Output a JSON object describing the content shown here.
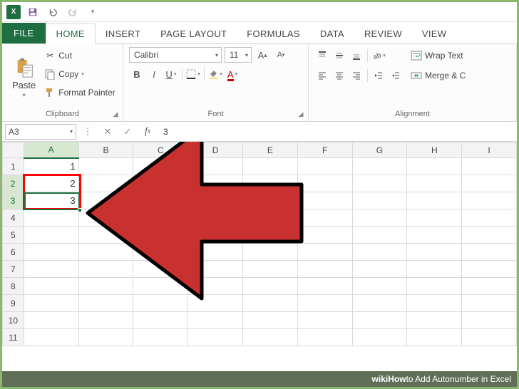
{
  "qat": {
    "app": "X"
  },
  "tabs": {
    "file": "FILE",
    "home": "HOME",
    "insert": "INSERT",
    "pagelayout": "PAGE LAYOUT",
    "formulas": "FORMULAS",
    "data": "DATA",
    "review": "REVIEW",
    "view": "VIEW"
  },
  "ribbon": {
    "clipboard": {
      "paste": "Paste",
      "cut": "Cut",
      "copy": "Copy",
      "painter": "Format Painter",
      "label": "Clipboard"
    },
    "font": {
      "name": "Calibri",
      "size": "11",
      "label": "Font"
    },
    "alignment": {
      "wrap": "Wrap Text",
      "merge": "Merge & C",
      "label": "Alignment"
    }
  },
  "formula": {
    "namebox": "A3",
    "value": "3"
  },
  "grid": {
    "cols": [
      "A",
      "B",
      "C",
      "D",
      "E",
      "F",
      "G",
      "H",
      "I"
    ],
    "rows": [
      "1",
      "2",
      "3",
      "4",
      "5",
      "6",
      "7",
      "8",
      "9",
      "10",
      "11"
    ],
    "cells": {
      "A1": "1",
      "A2": "2",
      "A3": "3"
    }
  },
  "caption": {
    "prefix": "wiki",
    "how": "How",
    "rest": " to Add Autonumber in Excel"
  }
}
